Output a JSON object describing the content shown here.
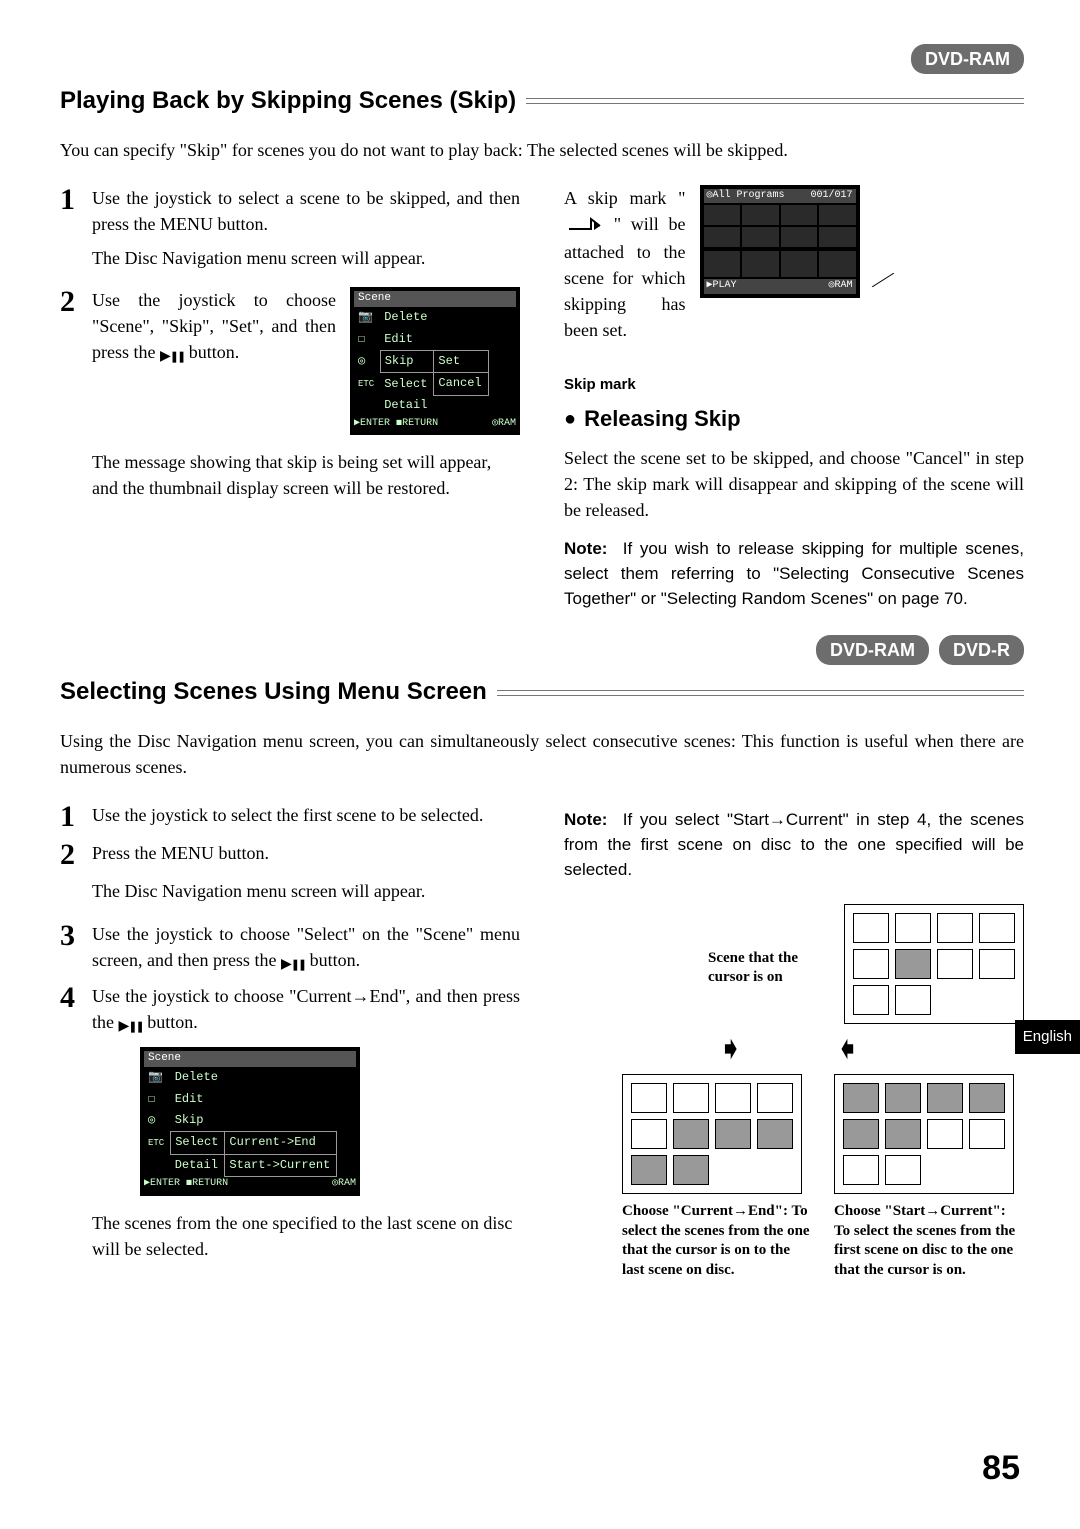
{
  "badges": {
    "dvd_ram": "DVD-RAM",
    "dvd_r": "DVD-R"
  },
  "section1": {
    "title": "Playing Back by Skipping Scenes (Skip)",
    "intro": "You can specify \"Skip\" for scenes you do not want to play back: The selected scenes will be skipped.",
    "step1": "Use the joystick to select a scene to be skipped, and then press the MENU button.",
    "step1b": "The Disc Navigation menu screen will appear.",
    "step2_a": "Use the joystick to choose \"Scene\", \"Skip\", \"Set\", and then press the ",
    "step2_btn": " button.",
    "step2_after": "The message showing that skip is being set will appear, and the thumbnail display screen will be restored.",
    "right_a_pre": "A skip mark \" ",
    "right_a_post": " \" will be attached to the scene for which skipping has been set.",
    "skip_mark_label": "Skip mark",
    "releasing_h": "Releasing Skip",
    "releasing_p": "Select the scene set to be skipped, and choose \"Cancel\" in step 2: The skip mark will disappear and skipping of the scene will be released.",
    "note_label": "Note:",
    "note_body": "If you wish to release skipping for multiple scenes, select them referring to \"Selecting Consecutive Scenes Together\" or \"Selecting Random Scenes\" on page 70."
  },
  "section2": {
    "title": "Selecting Scenes Using Menu Screen",
    "intro": "Using the Disc Navigation menu screen, you can simultaneously select consecutive scenes: This function is useful when there are numerous scenes.",
    "step1": "Use the joystick to select the first scene to be selected.",
    "step2": "Press the MENU button.",
    "step2b": "The Disc Navigation menu screen will appear.",
    "step3_a": "Use the joystick to choose \"Select\" on the \"Scene\" menu screen, and then press the ",
    "step3_btn": " button.",
    "step4_a": "Use the joystick to choose \"Current→End\", and then press the ",
    "step4_btn": " button.",
    "step4_after": "The scenes from the one specified to the last scene on disc will be selected.",
    "r_note_label": "Note:",
    "r_note_body": "If you select \"Start→Current\" in step 4, the scenes from the first scene on disc to the one specified will be selected.",
    "cursor_label": "Scene that the cursor is on",
    "cap_end": "Choose \"Current→End\": To select the scenes from the one that the cursor is on to the last scene on disc.",
    "cap_start": "Choose \"Start→Current\": To select the scenes from the first scene on disc to the one that the cursor is on."
  },
  "lcd_menu": {
    "head": "Scene",
    "rows": [
      "Delete",
      "Edit",
      "Skip",
      "Select",
      "Detail"
    ],
    "sub_set": "Set",
    "sub_cancel": "Cancel",
    "sub_cur_end": "Current->End",
    "sub_start_cur": "Start->Current",
    "ftr_enter": "ENTER",
    "ftr_return": "RETURN",
    "ftr_ram": "RAM"
  },
  "thumbs_lcd": {
    "head_left": "All Programs",
    "head_right": "001/017",
    "ftr_left": "PLAY",
    "ftr_right": "RAM"
  },
  "side_tab": "English",
  "page_number": "85"
}
